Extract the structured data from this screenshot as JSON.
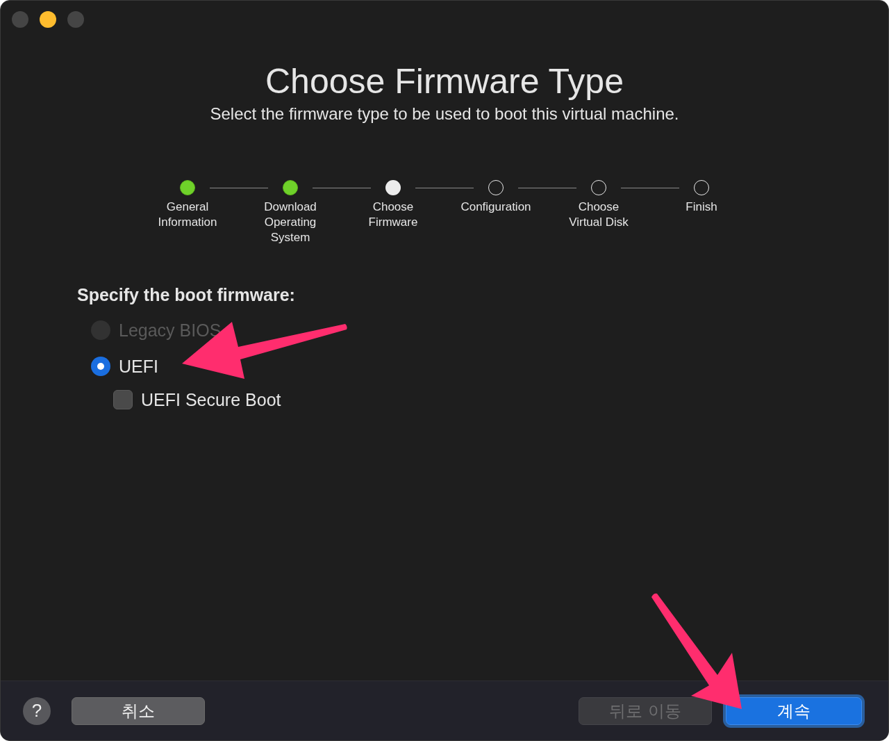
{
  "window": {
    "controls": [
      {
        "kind": "inactive"
      },
      {
        "kind": "minimize"
      },
      {
        "kind": "inactive"
      }
    ]
  },
  "title": "Choose Firmware Type",
  "subtitle": "Select the firmware type to be used to boot this virtual machine.",
  "steps": [
    {
      "label": "General Information",
      "completed": true,
      "selected": false
    },
    {
      "label": "Download Operating System",
      "completed": true,
      "selected": false
    },
    {
      "label": "Choose Firmware",
      "completed": false,
      "selected": true
    },
    {
      "label": "Configuration",
      "completed": false,
      "selected": false
    },
    {
      "label": "Choose Virtual Disk",
      "completed": false,
      "selected": false
    },
    {
      "label": "Finish",
      "completed": false,
      "selected": false
    }
  ],
  "section_heading": "Specify the boot firmware:",
  "options": [
    {
      "kind": "radio",
      "label": "Legacy BIOS",
      "selected": false,
      "disabled": true
    },
    {
      "kind": "radio",
      "label": "UEFI",
      "selected": true,
      "disabled": false
    },
    {
      "kind": "checkbox",
      "label": "UEFI Secure Boot",
      "checked": false,
      "disabled": false
    }
  ],
  "footer": {
    "help": "?",
    "buttons": [
      {
        "label": "취소",
        "kind": "normal",
        "disabled": false
      },
      {
        "label": "뒤로 이동",
        "kind": "normal",
        "disabled": true
      },
      {
        "label": "계속",
        "kind": "primary",
        "disabled": false
      }
    ]
  },
  "annotations": [
    {
      "kind": "arrow"
    },
    {
      "kind": "arrow"
    }
  ]
}
